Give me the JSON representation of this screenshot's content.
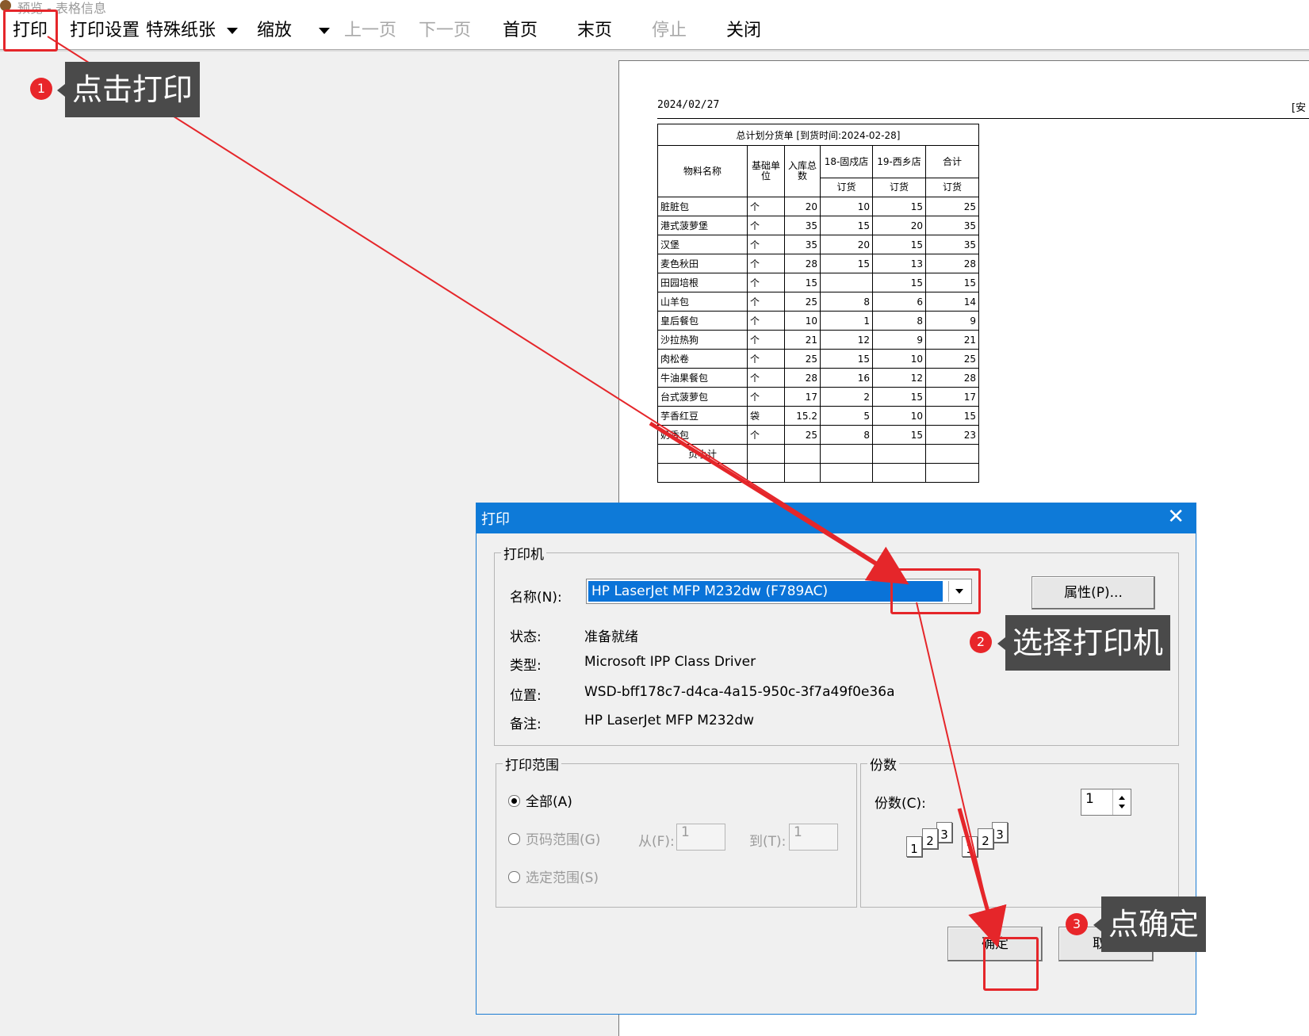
{
  "window": {
    "title": "预览 - 表格信息"
  },
  "toolbar": {
    "print": "打印",
    "print_settings": "打印设置",
    "special_paper": "特殊纸张",
    "zoom": "缩放",
    "prev_page": "上一页",
    "next_page": "下一页",
    "first_page": "首页",
    "last_page": "末页",
    "stop": "停止",
    "close": "关闭"
  },
  "report": {
    "date": "2024/02/27",
    "right_note": "[安",
    "caption": "总计划分货单 [到货时间:2024-02-28]",
    "headers": {
      "name": "物料名称",
      "unit": "基础单位",
      "qty": "入库总数",
      "store1": "18-固戍店",
      "store2": "19-西乡店",
      "total": "合计",
      "order": "订货"
    },
    "rows": [
      [
        "脏脏包",
        "个",
        "20",
        "10",
        "15",
        "25"
      ],
      [
        "港式菠萝堡",
        "个",
        "35",
        "15",
        "20",
        "35"
      ],
      [
        "汉堡",
        "个",
        "35",
        "20",
        "15",
        "35"
      ],
      [
        "麦色秋田",
        "个",
        "28",
        "15",
        "13",
        "28"
      ],
      [
        "田园培根",
        "个",
        "15",
        "",
        "15",
        "15"
      ],
      [
        "山羊包",
        "个",
        "25",
        "8",
        "6",
        "14"
      ],
      [
        "皇后餐包",
        "个",
        "10",
        "1",
        "8",
        "9"
      ],
      [
        "沙拉热狗",
        "个",
        "21",
        "12",
        "9",
        "21"
      ],
      [
        "肉松卷",
        "个",
        "25",
        "15",
        "10",
        "25"
      ],
      [
        "牛油果餐包",
        "个",
        "28",
        "16",
        "12",
        "28"
      ],
      [
        "台式菠萝包",
        "个",
        "17",
        "2",
        "15",
        "17"
      ],
      [
        "芋香红豆",
        "袋",
        "15.2",
        "5",
        "10",
        "15"
      ],
      [
        "奶香包",
        "个",
        "25",
        "8",
        "15",
        "23"
      ]
    ],
    "subtotal_label": "页小计"
  },
  "dialog": {
    "title": "打印",
    "printer_group": "打印机",
    "name_label": "名称(N):",
    "printer_name": "HP LaserJet MFP M232dw (F789AC)",
    "properties_btn": "属性(P)...",
    "status_label": "状态:",
    "status_value": "准备就绪",
    "type_label": "类型:",
    "type_value": "Microsoft IPP Class Driver",
    "where_label": "位置:",
    "where_value": "WSD-bff178c7-d4ca-4a15-950c-3f7a49f0e36a",
    "comment_label": "备注:",
    "comment_value": "HP LaserJet MFP M232dw",
    "range_group": "打印范围",
    "all": "全部(A)",
    "pages": "页码范围(G)",
    "from_label": "从(F):",
    "from_value": "1",
    "to_label": "到(T):",
    "to_value": "1",
    "selection": "选定范围(S)",
    "copies_group": "份数",
    "copies_label": "份数(C):",
    "copies_value": "1",
    "ok": "确定",
    "cancel": "取消",
    "collate_digits": [
      "1",
      "2",
      "3"
    ]
  },
  "annotations": {
    "step1_num": "1",
    "step1": "点击打印",
    "step2_num": "2",
    "step2": "选择打印机",
    "step3_num": "3",
    "step3": "点确定",
    "accent_color": "#e5262a"
  }
}
